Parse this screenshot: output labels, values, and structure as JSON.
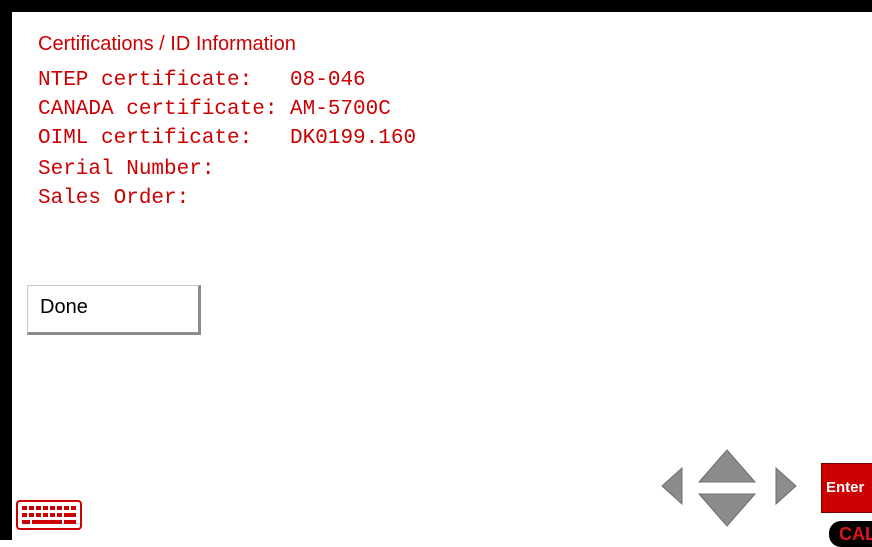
{
  "screen": {
    "title": "Certifications / ID Information",
    "lines": [
      "NTEP certificate:   08-046",
      "CANADA certificate: AM-5700C",
      "OIML certificate:   DK0199.160",
      "Serial Number:",
      "Sales Order:"
    ]
  },
  "buttons": {
    "done_label": "Done",
    "enter_label": "Enter",
    "cal_label": "CAL"
  },
  "icons": {
    "keyboard": "keyboard-icon",
    "left": "arrow-left-icon",
    "up": "arrow-up-icon",
    "down": "arrow-down-icon",
    "right": "arrow-right-icon"
  },
  "colors": {
    "accent_text": "#cc0000",
    "enter_bg": "#cc0000",
    "cal_bg": "#000000",
    "cal_text": "#e0141e",
    "frame": "#000000"
  }
}
